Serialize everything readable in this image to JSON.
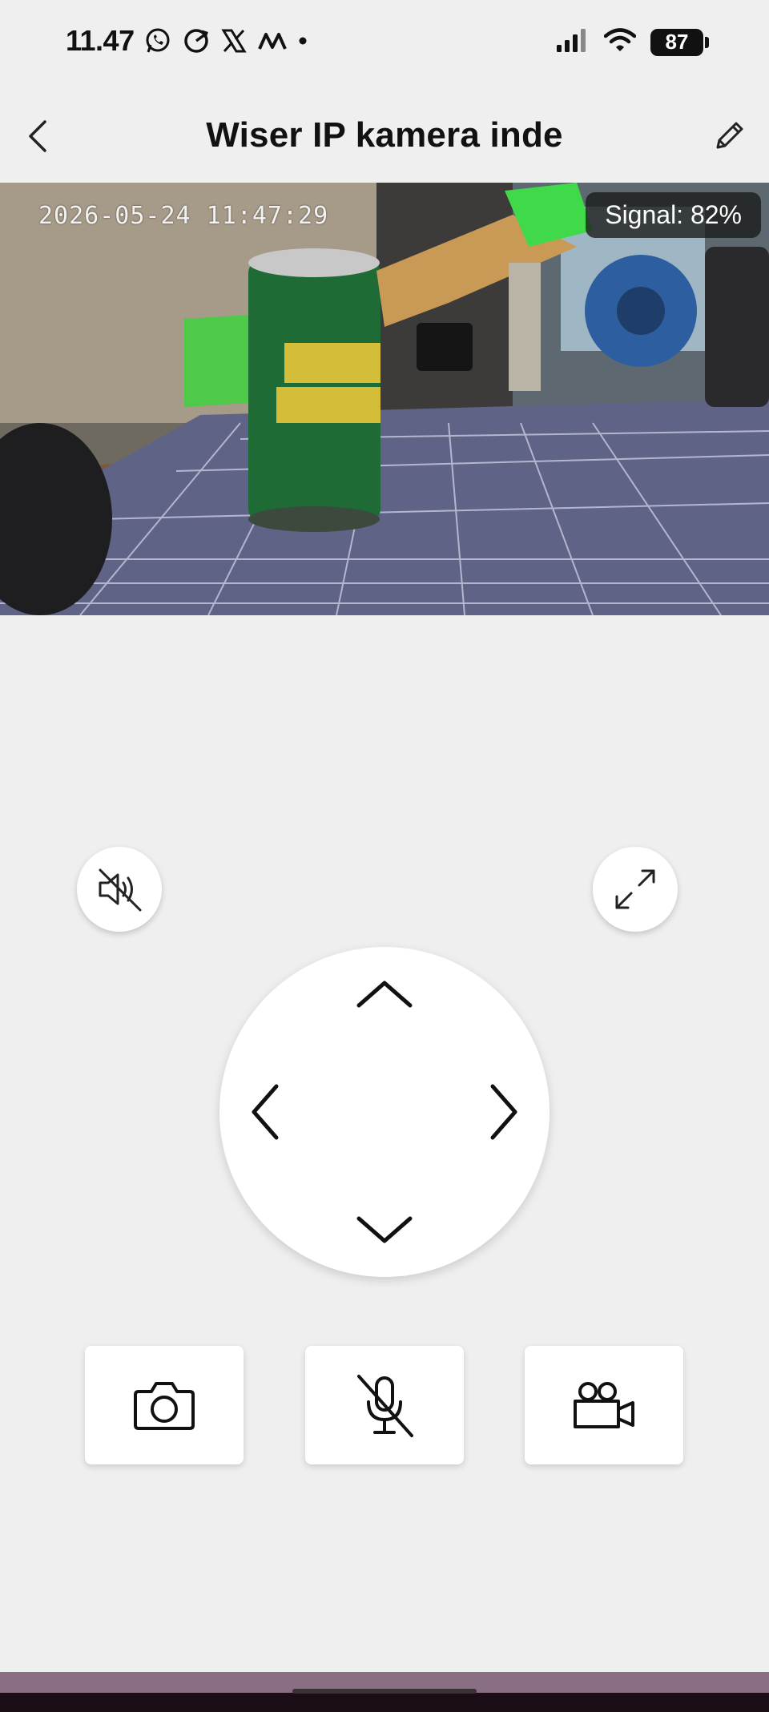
{
  "status_bar": {
    "time": "11.47",
    "notification_icons": [
      "whatsapp-icon",
      "refresh-circle-icon",
      "x-logo-icon",
      "m-logo-icon",
      "dot-icon"
    ],
    "battery_level": "87",
    "signal_icon": "cellular-signal-icon",
    "wifi_icon": "wifi-icon"
  },
  "header": {
    "title": "Wiser IP kamera inde",
    "back_icon": "chevron-left-icon",
    "edit_icon": "pencil-icon"
  },
  "camera": {
    "timestamp": "2026-05-24 11:47:29",
    "signal_text": "Signal: 82%"
  },
  "controls": {
    "speaker_icon": "speaker-muted-icon",
    "fullscreen_icon": "expand-arrows-icon",
    "ptz": {
      "up_icon": "chevron-up-icon",
      "down_icon": "chevron-down-icon",
      "left_icon": "chevron-left-icon",
      "right_icon": "chevron-right-icon"
    },
    "actions": {
      "snapshot_icon": "camera-icon",
      "mic_icon": "microphone-muted-icon",
      "record_icon": "video-camera-icon"
    }
  },
  "colors": {
    "background": "#efefef",
    "surface": "#ffffff",
    "icon": "#111111",
    "badge_bg": "#191919",
    "nav_strip": "#8a6f84"
  }
}
